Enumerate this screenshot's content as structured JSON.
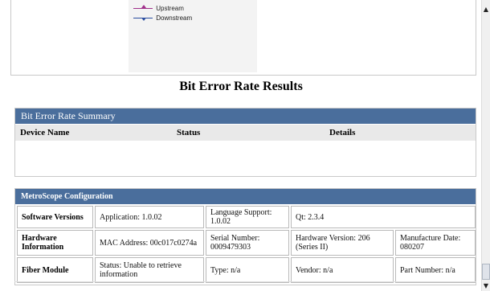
{
  "legend": {
    "upstream": "Upstream",
    "downstream": "Downstream",
    "upstream_color": "#a0308a",
    "downstream_color": "#2a4da0"
  },
  "page_title": "Bit Error Rate Results",
  "bert_summary": {
    "header": "Bit Error Rate Summary",
    "columns": [
      "Device Name",
      "Status",
      "Details"
    ]
  },
  "metroscope": {
    "header": "MetroScope Configuration",
    "rows": [
      {
        "label": "Software Versions",
        "cells": [
          "Application: 1.0.02",
          "Language Support: 1.0.02",
          "Qt: 2.3.4",
          ""
        ]
      },
      {
        "label": "Hardware Information",
        "cells": [
          "MAC Address: 00c017c0274a",
          "Serial Number: 0009479303",
          "Hardware Version: 206 (Series II)",
          "Manufacture Date: 080207"
        ]
      },
      {
        "label": "Fiber Module",
        "cells": [
          "Status: Unable to retrieve information",
          "Type: n/a",
          "Vendor: n/a",
          "Part Number: n/a"
        ]
      }
    ]
  },
  "scrollbar": {
    "up_icon": "chevron-up-icon",
    "down_icon": "chevron-down-icon",
    "up_glyph": "▲",
    "down_glyph": "▼"
  }
}
